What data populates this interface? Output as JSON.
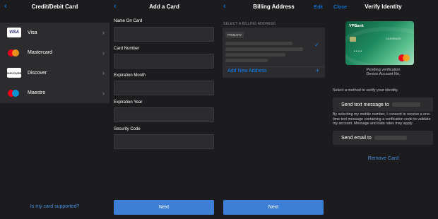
{
  "colors": {
    "accent": "#0a84ff",
    "button": "#3d7fd6",
    "background": "#1c1c1e",
    "cell": "#2c2c2e"
  },
  "screen1": {
    "title": "Credit/Debit Card",
    "back_icon": "chevron-left-icon",
    "cards": [
      {
        "label": "Visa",
        "logo": "VISA"
      },
      {
        "label": "Mastercard",
        "logo": "mastercard-logo"
      },
      {
        "label": "Discover",
        "logo": "DISCOVER"
      },
      {
        "label": "Maestro",
        "logo": "maestro-logo"
      }
    ],
    "supported_link": "Is my card supported?"
  },
  "screen2": {
    "title": "Add a Card",
    "back_icon": "chevron-left-icon",
    "fields": [
      {
        "label": "Name On Card",
        "value": ""
      },
      {
        "label": "Card Number",
        "value": ""
      },
      {
        "label": "Expiration Month",
        "value": ""
      },
      {
        "label": "Expiration Year",
        "value": ""
      },
      {
        "label": "Security Code",
        "value": ""
      }
    ],
    "next_label": "Next"
  },
  "screen3": {
    "title": "Billing Address",
    "back_icon": "chevron-left-icon",
    "edit_label": "Edit",
    "section_header": "SELECT A BILLING ADDRESS",
    "primary_tag": "PRIMARY",
    "add_address_label": "Add New Address",
    "add_icon": "plus-icon",
    "check_icon": "checkmark-icon",
    "next_label": "Next"
  },
  "screen4": {
    "close_label": "Close",
    "title": "Verify Identity",
    "card_brand": "VPBank",
    "card_tagline": "CASHBACK",
    "card_number_masked": "• • • •",
    "pending_text": "Pending verification",
    "device_account_label": "Device Account No.",
    "select_method_text": "Select a method to verify your identity.",
    "text_message_label": "Send text message to",
    "consent_text": "By selecting my mobile number, I consent to receive a one-time text message containing a verification code to validate my account. Message and data rates may apply.",
    "email_label": "Send email to",
    "remove_card_label": "Remove Card"
  }
}
